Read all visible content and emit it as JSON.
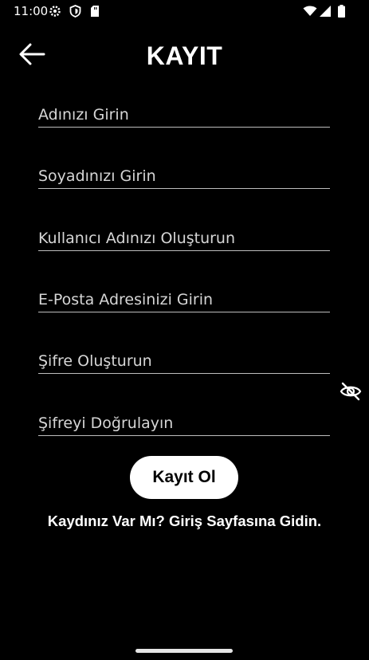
{
  "status_bar": {
    "time": "11:00",
    "left_icons": [
      "gear-icon",
      "shield-icon",
      "sd-card-icon"
    ],
    "right_icons": [
      "wifi-icon",
      "signal-icon",
      "battery-icon"
    ]
  },
  "header": {
    "title": "KAYIT",
    "back_icon": "arrow-left-icon"
  },
  "form": {
    "fields": [
      {
        "placeholder": "Adınızı Girin",
        "value": ""
      },
      {
        "placeholder": "Soyadınızı Girin",
        "value": ""
      },
      {
        "placeholder": "Kullanıcı Adınızı Oluşturun",
        "value": ""
      },
      {
        "placeholder": "E-Posta Adresinizi Girin",
        "value": ""
      },
      {
        "placeholder": "Şifre Oluşturun",
        "value": ""
      },
      {
        "placeholder": "Şifreyi Doğrulayın",
        "value": ""
      }
    ],
    "password_toggle_icon": "eye-off-icon",
    "submit_label": "Kayıt Ol",
    "login_prompt": "Kaydınız Var Mı? Giriş Sayfasına Gidin."
  },
  "colors": {
    "background": "#000000",
    "text": "#ffffff",
    "underline": "#bdbdbd",
    "button_bg": "#ffffff",
    "button_text": "#000000"
  }
}
